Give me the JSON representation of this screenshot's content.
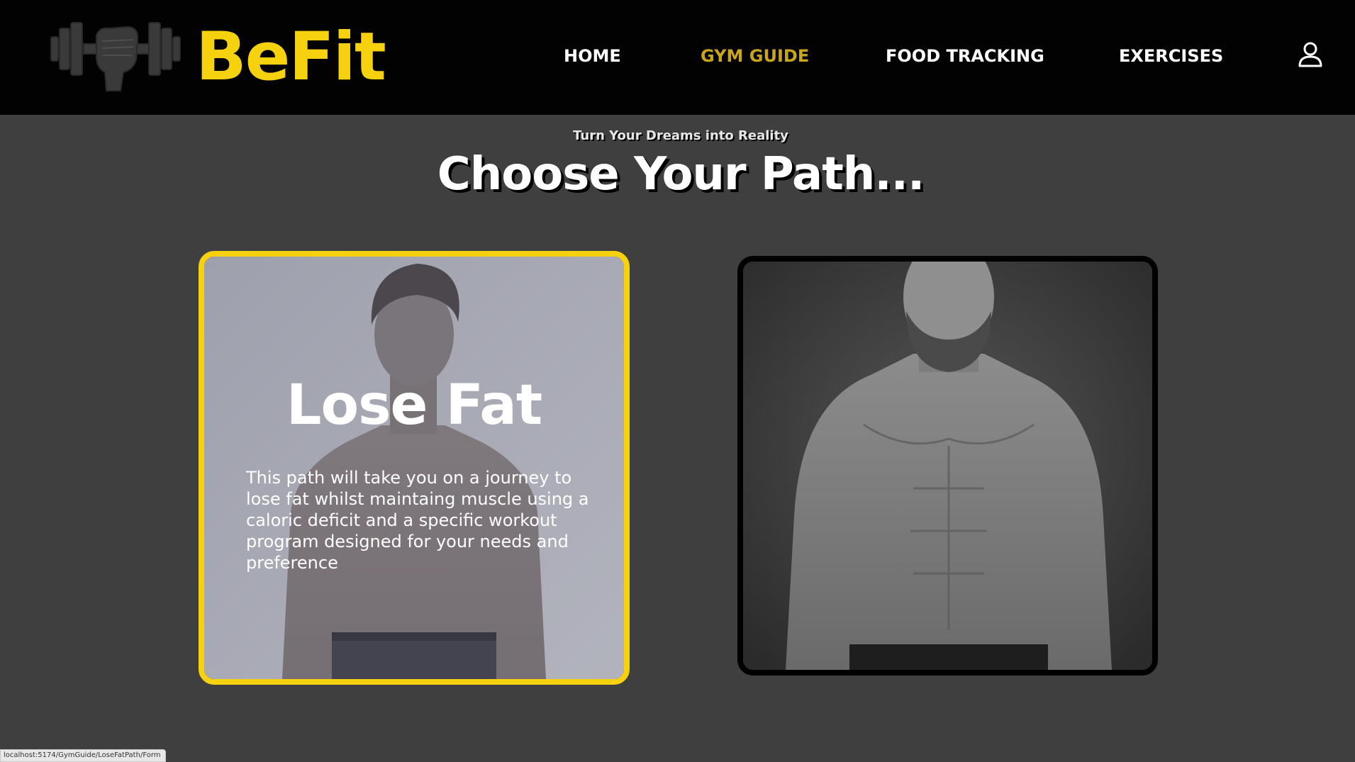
{
  "header": {
    "brand": "BeFit",
    "logo_icon": "dumbbell-fist-icon",
    "nav": [
      {
        "label": "HOME",
        "active": false
      },
      {
        "label": "GYM GUIDE",
        "active": true
      },
      {
        "label": "FOOD TRACKING",
        "active": false
      },
      {
        "label": "EXERCISES",
        "active": false
      }
    ],
    "user_icon": "user-icon"
  },
  "hero": {
    "subtitle": "Turn Your Dreams into Reality",
    "title": "Choose Your Path..."
  },
  "cards": [
    {
      "title": "Lose Fat",
      "description": "This path will take you on a journey to lose fat whilst maintaing muscle using a caloric deficit and a specific workout program designed for your needs and preference",
      "highlighted": true
    },
    {
      "highlighted": false
    }
  ],
  "status_bar": {
    "url": "localhost:5174/GymGuide/LoseFatPath/Form"
  },
  "colors": {
    "accent": "#f6d10e",
    "active_nav": "#c8a51a",
    "background": "#3f3f3f",
    "navbar": "#020202"
  }
}
